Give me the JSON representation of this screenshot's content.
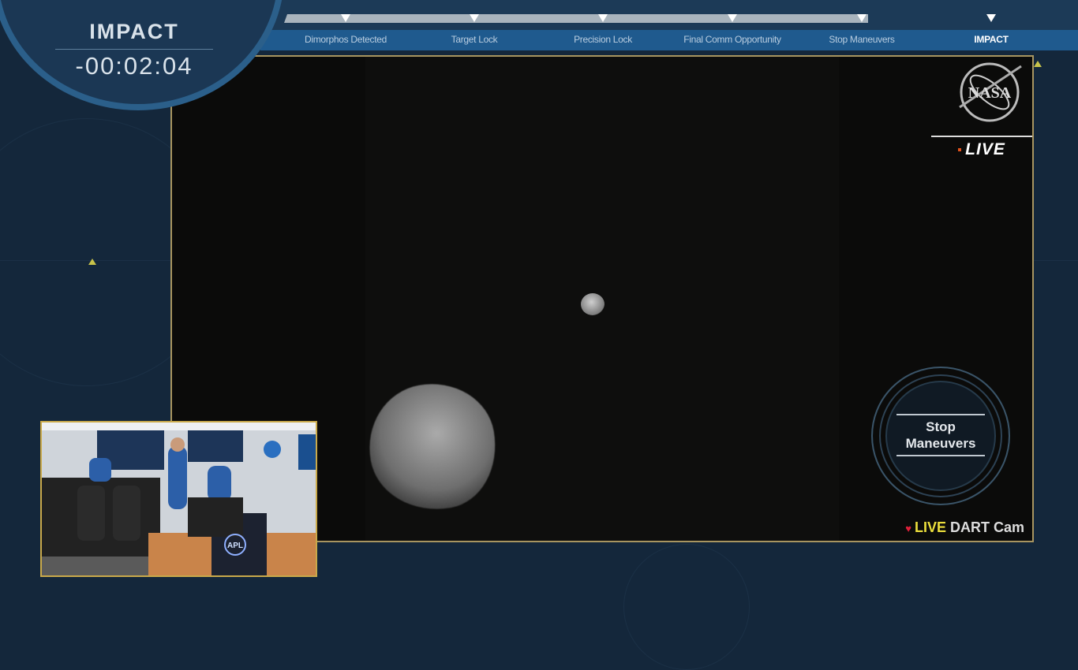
{
  "countdown": {
    "title": "IMPACT",
    "time": "-00:02:04"
  },
  "timeline": {
    "milestones": [
      {
        "label": "Dimorphos Detected"
      },
      {
        "label": "Target Lock"
      },
      {
        "label": "Precision Lock"
      },
      {
        "label": "Final Comm Opportunity"
      },
      {
        "label": "Stop Maneuvers"
      },
      {
        "label": "IMPACT"
      }
    ]
  },
  "video": {
    "logo": "NASA",
    "live_badge": "LIVE",
    "current_phase": "Stop Maneuvers",
    "cam_live": "LIVE",
    "cam_name": "DART Cam"
  },
  "inset": {
    "logo": "APL"
  },
  "colors": {
    "accent_gold": "#a89560",
    "live_yellow": "#ecdf3c",
    "live_red": "#e0203a",
    "bar_blue": "#1f5a8e"
  }
}
